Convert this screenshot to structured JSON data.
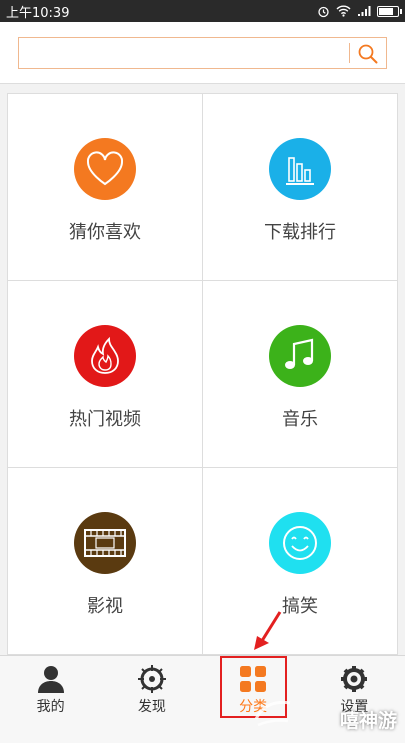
{
  "status_bar": {
    "time": "上午10:39"
  },
  "search": {
    "value": "",
    "placeholder": ""
  },
  "categories": [
    {
      "label": "猜你喜欢",
      "color": "#f47920",
      "icon": "heart-icon"
    },
    {
      "label": "下载排行",
      "color": "#1ab0e8",
      "icon": "bar-chart-icon"
    },
    {
      "label": "热门视频",
      "color": "#e21818",
      "icon": "flame-icon"
    },
    {
      "label": "音乐",
      "color": "#3cb21a",
      "icon": "music-note-icon"
    },
    {
      "label": "影视",
      "color": "#5a3a10",
      "icon": "film-strip-icon"
    },
    {
      "label": "搞笑",
      "color": "#1fe0f0",
      "icon": "smiley-icon"
    }
  ],
  "tabs": [
    {
      "label": "我的",
      "icon": "user-icon"
    },
    {
      "label": "发现",
      "icon": "compass-icon"
    },
    {
      "label": "分类",
      "icon": "grid-icon",
      "active": true
    },
    {
      "label": "设置",
      "icon": "gear-icon"
    }
  ],
  "watermark": "嘻神游"
}
